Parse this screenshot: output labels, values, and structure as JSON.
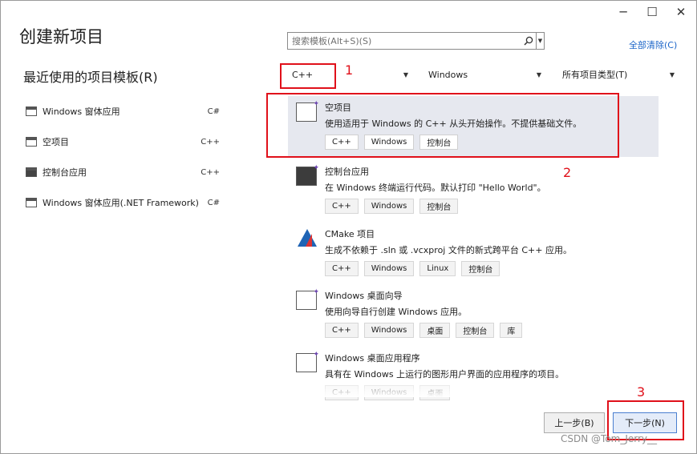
{
  "window": {
    "title": "创建新项目",
    "controls": {
      "minimize": "─",
      "maximize": "☐",
      "close": "✕"
    }
  },
  "search": {
    "placeholder": "搜索模板(Alt+S)(S)"
  },
  "clear_all": "全部清除(C)",
  "recent": {
    "title": "最近使用的项目模板(R)",
    "items": [
      {
        "label": "Windows 窗体应用",
        "lang": "C#"
      },
      {
        "label": "空项目",
        "lang": "C++"
      },
      {
        "label": "控制台应用",
        "lang": "C++"
      },
      {
        "label": "Windows 窗体应用(.NET Framework)",
        "lang": "C#"
      }
    ]
  },
  "filters": {
    "language": "C++",
    "platform": "Windows",
    "project_type": "所有项目类型(T)"
  },
  "templates": [
    {
      "name": "空项目",
      "desc": "使用适用于 Windows 的 C++ 从头开始操作。不提供基础文件。",
      "tags": [
        "C++",
        "Windows",
        "控制台"
      ],
      "icon": "empty-project-icon"
    },
    {
      "name": "控制台应用",
      "desc": "在 Windows 终端运行代码。默认打印 \"Hello World\"。",
      "tags": [
        "C++",
        "Windows",
        "控制台"
      ],
      "icon": "console-app-icon"
    },
    {
      "name": "CMake 项目",
      "desc": "生成不依赖于 .sln 或 .vcxproj 文件的新式跨平台 C++ 应用。",
      "tags": [
        "C++",
        "Windows",
        "Linux",
        "控制台"
      ],
      "icon": "cmake-icon"
    },
    {
      "name": "Windows 桌面向导",
      "desc": "使用向导自行创建 Windows 应用。",
      "tags": [
        "C++",
        "Windows",
        "桌面",
        "控制台",
        "库"
      ],
      "icon": "desktop-wizard-icon"
    },
    {
      "name": "Windows 桌面应用程序",
      "desc": "具有在 Windows 上运行的图形用户界面的应用程序的项目。",
      "tags": [
        "C++",
        "Windows",
        "桌面"
      ],
      "icon": "desktop-app-icon"
    }
  ],
  "annotations": [
    "1",
    "2",
    "3"
  ],
  "buttons": {
    "back": "上一步(B)",
    "next": "下一步(N)"
  },
  "watermark": "CSDN @Tom_Jerry__",
  "colors": {
    "accent": "#1a64c8",
    "highlight_red": "#e0101a",
    "selected_bg": "#e6e8ef"
  }
}
